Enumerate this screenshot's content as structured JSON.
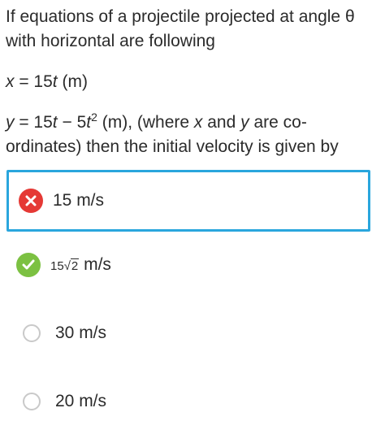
{
  "question": {
    "line1": "If equations of a projectile projected at angle θ with horizontal are following",
    "eq_x": {
      "var": "x",
      "rest_pre": " = 15",
      "t": "t",
      "unit": " (m)"
    },
    "eq_y": {
      "var": "y",
      "part1": " = 15",
      "t1": "t",
      "part2": " − 5",
      "t2": "t",
      "exp": "2",
      "part3": " (m), (where ",
      "x": "x",
      "and": " and ",
      "y2": "y",
      "part4": " are co-ordinates) then the initial velocity is given by"
    }
  },
  "options": [
    {
      "label": "15 m/s",
      "status": "wrong",
      "icon": "cross-icon"
    },
    {
      "coef": "15",
      "radicand": "2",
      "unit": " m/s",
      "status": "correct",
      "icon": "check-icon"
    },
    {
      "label": "30 m/s",
      "status": "unselected",
      "icon": "radio-icon"
    },
    {
      "label": "20 m/s",
      "status": "unselected",
      "icon": "radio-icon"
    }
  ],
  "colors": {
    "selected_border": "#2aa6dd",
    "wrong": "#e53935",
    "correct": "#7cc142",
    "radio_border": "#c9c9c9"
  }
}
